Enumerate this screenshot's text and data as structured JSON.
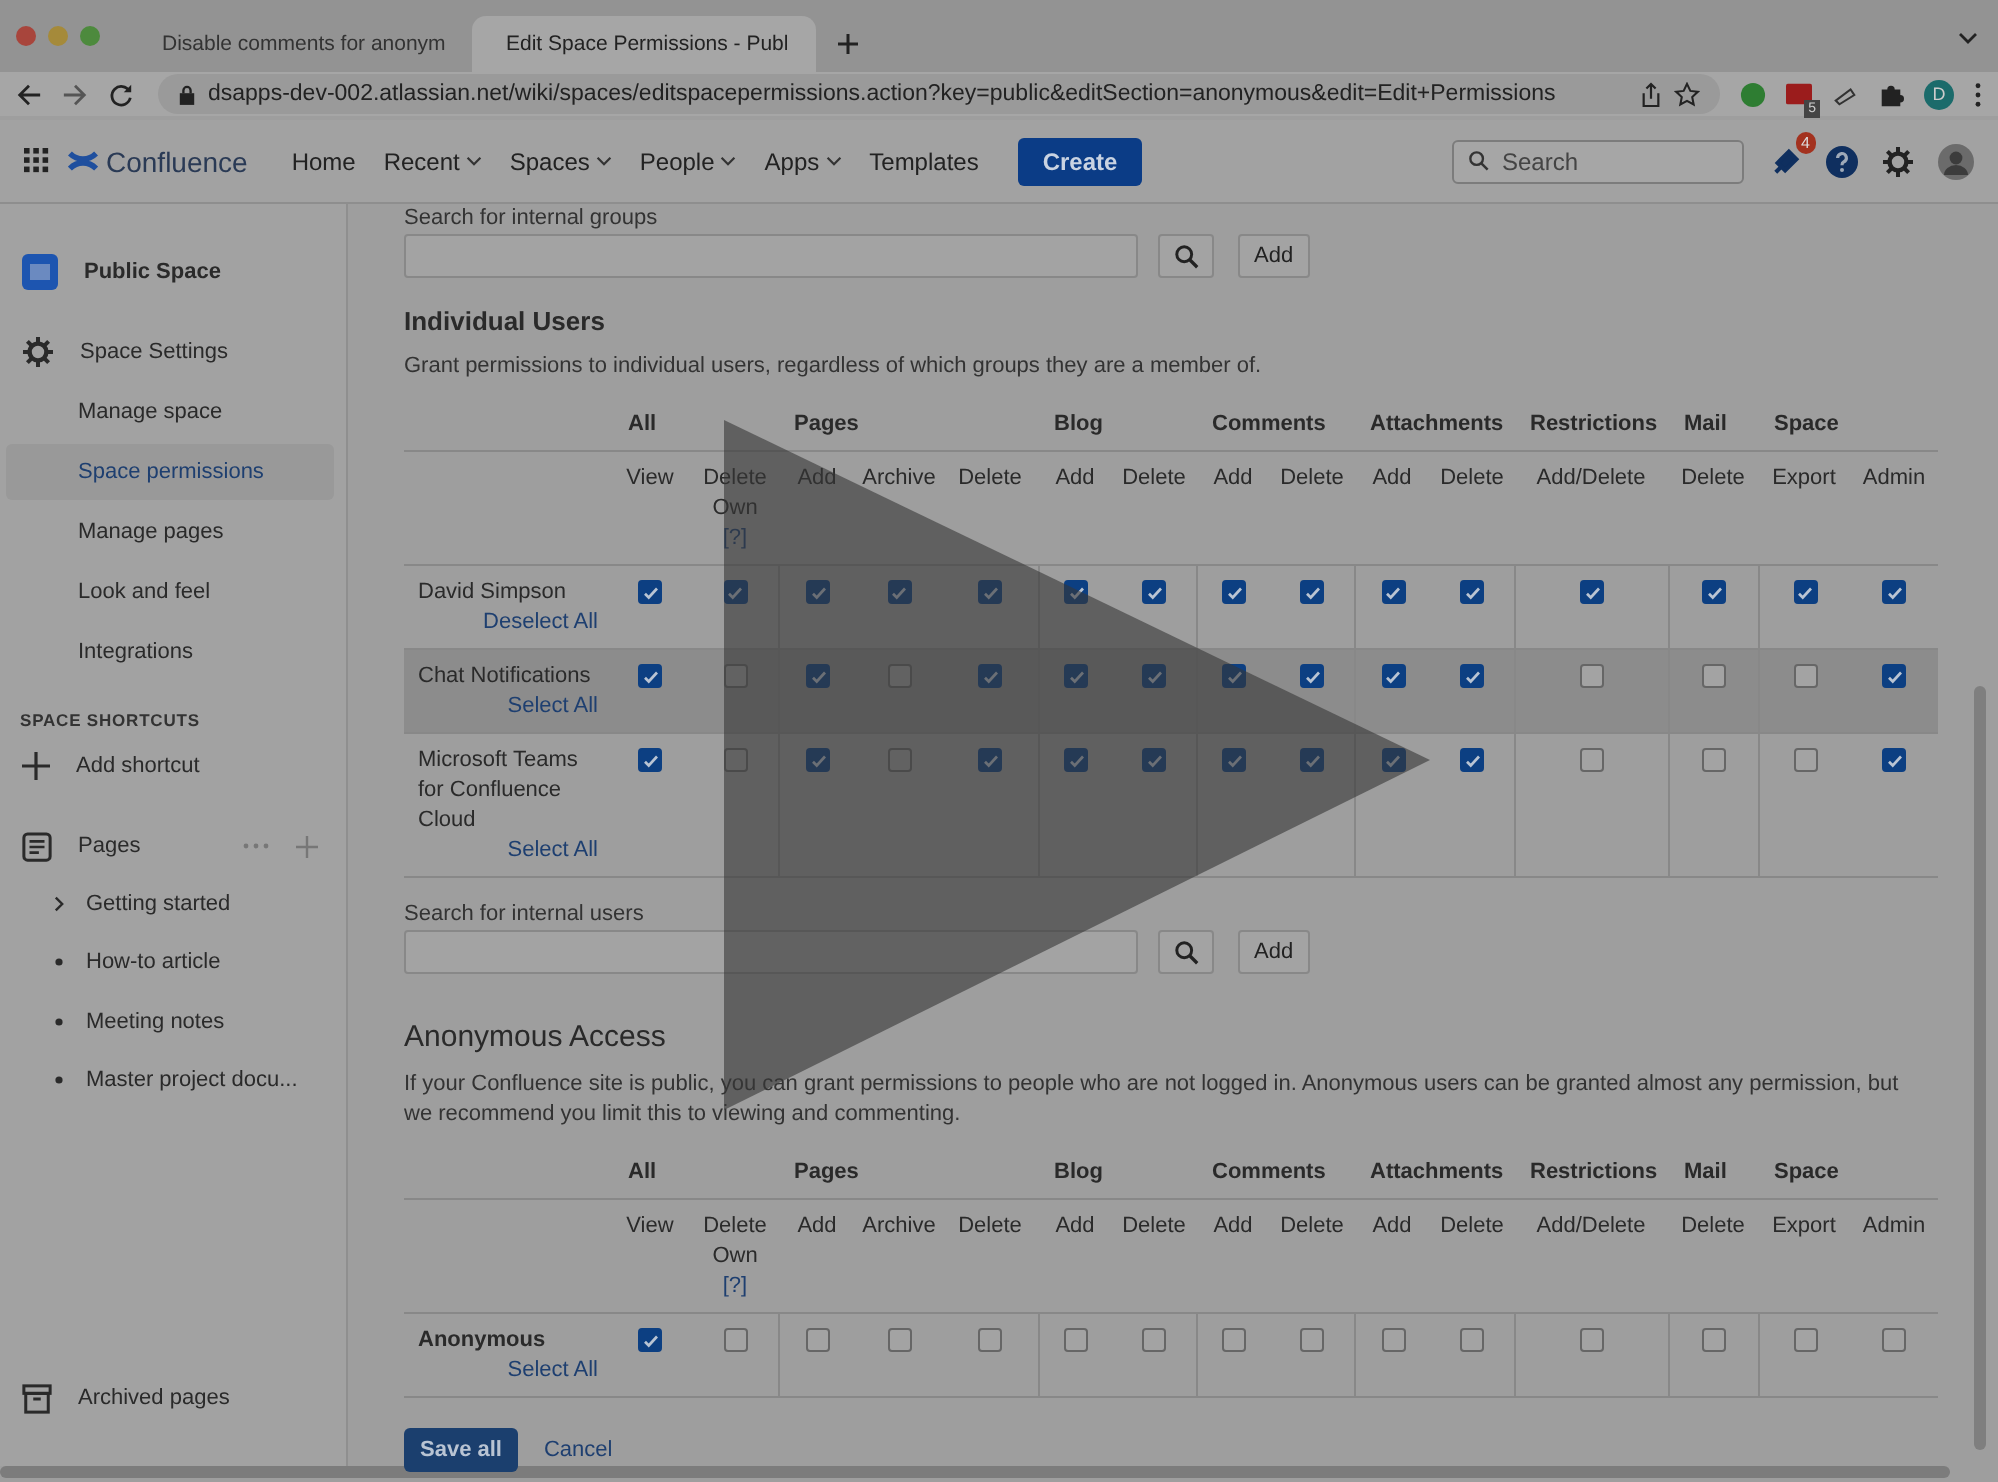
{
  "browser": {
    "tabs": [
      {
        "title": "Disable comments for anonym",
        "selected": false
      },
      {
        "title": "Edit Space Permissions - Publ",
        "selected": true
      }
    ],
    "url": "dsapps-dev-002.atlassian.net/wiki/spaces/editspacepermissions.action?key=public&editSection=anonymous&edit=Edit+Permissions",
    "extension_badge": "5",
    "profile": "D"
  },
  "nav": {
    "product": "Confluence",
    "items": [
      {
        "label": "Home",
        "dropdown": false
      },
      {
        "label": "Recent",
        "dropdown": true
      },
      {
        "label": "Spaces",
        "dropdown": true
      },
      {
        "label": "People",
        "dropdown": true
      },
      {
        "label": "Apps",
        "dropdown": true
      },
      {
        "label": "Templates",
        "dropdown": false
      }
    ],
    "create": "Create",
    "search": {
      "placeholder": "Search"
    },
    "notifications": "4"
  },
  "sidebar": {
    "space": "Public Space",
    "settings": {
      "label": "Space Settings",
      "items": [
        {
          "label": "Manage space",
          "selected": false
        },
        {
          "label": "Space permissions",
          "selected": true
        },
        {
          "label": "Manage pages",
          "selected": false
        },
        {
          "label": "Look and feel",
          "selected": false
        },
        {
          "label": "Integrations",
          "selected": false
        }
      ]
    },
    "shortcuts": {
      "heading": "SPACE SHORTCUTS",
      "add": "Add shortcut"
    },
    "pages": {
      "label": "Pages",
      "items": [
        {
          "label": "Getting started",
          "kind": "expandable"
        },
        {
          "label": "How-to article",
          "kind": "leaf"
        },
        {
          "label": "Meeting notes",
          "kind": "leaf"
        },
        {
          "label": "Master project docu...",
          "kind": "leaf"
        }
      ]
    },
    "archived": "Archived pages"
  },
  "groups_search": {
    "label": "Search for internal groups",
    "add": "Add"
  },
  "individual_users": {
    "heading": "Individual Users",
    "description": "Grant permissions to individual users, regardless of which groups they are a member of.",
    "groups": [
      {
        "label": "All",
        "columns": [
          {
            "label": "View"
          },
          {
            "label": "Delete Own",
            "help": "[?]"
          }
        ]
      },
      {
        "label": "Pages",
        "columns": [
          {
            "label": "Add"
          },
          {
            "label": "Archive"
          },
          {
            "label": "Delete"
          }
        ]
      },
      {
        "label": "Blog",
        "columns": [
          {
            "label": "Add"
          },
          {
            "label": "Delete"
          }
        ]
      },
      {
        "label": "Comments",
        "columns": [
          {
            "label": "Add"
          },
          {
            "label": "Delete"
          }
        ]
      },
      {
        "label": "Attachments",
        "columns": [
          {
            "label": "Add"
          },
          {
            "label": "Delete"
          }
        ]
      },
      {
        "label": "Restrictions",
        "columns": [
          {
            "label": "Add/Delete"
          }
        ]
      },
      {
        "label": "Mail",
        "columns": [
          {
            "label": "Delete"
          }
        ]
      },
      {
        "label": "Space",
        "columns": [
          {
            "label": "Export"
          },
          {
            "label": "Admin"
          }
        ]
      }
    ],
    "rows": [
      {
        "name": "David Simpson",
        "kind": "user",
        "action": "Deselect All",
        "hovered": false,
        "permissions": [
          {
            "checked": true
          },
          {
            "checked": true
          },
          {
            "checked": true
          },
          {
            "checked": true
          },
          {
            "checked": true
          },
          {
            "checked": true
          },
          {
            "checked": true
          },
          {
            "checked": true
          },
          {
            "checked": true
          },
          {
            "checked": true
          },
          {
            "checked": true
          },
          {
            "checked": true
          },
          {
            "checked": true
          },
          {
            "checked": true
          },
          {
            "checked": true
          }
        ]
      },
      {
        "name": "Chat Notifications",
        "kind": "user",
        "action": "Select All",
        "hovered": true,
        "permissions": [
          {
            "checked": true
          },
          {
            "checked": false
          },
          {
            "checked": true
          },
          {
            "checked": false
          },
          {
            "checked": true
          },
          {
            "checked": true
          },
          {
            "checked": true
          },
          {
            "checked": true
          },
          {
            "checked": true
          },
          {
            "checked": true
          },
          {
            "checked": true
          },
          {
            "checked": false
          },
          {
            "checked": false
          },
          {
            "checked": false
          },
          {
            "checked": true
          }
        ]
      },
      {
        "name": "Microsoft Teams for Confluence Cloud",
        "kind": "user",
        "action": "Select All",
        "hovered": false,
        "permissions": [
          {
            "checked": true
          },
          {
            "checked": false
          },
          {
            "checked": true
          },
          {
            "checked": false
          },
          {
            "checked": true
          },
          {
            "checked": true
          },
          {
            "checked": true
          },
          {
            "checked": true
          },
          {
            "checked": true
          },
          {
            "checked": true
          },
          {
            "checked": true
          },
          {
            "checked": false
          },
          {
            "checked": false
          },
          {
            "checked": false
          },
          {
            "checked": true
          }
        ]
      }
    ]
  },
  "users_search": {
    "label": "Search for internal users",
    "add": "Add"
  },
  "anonymous": {
    "heading": "Anonymous Access",
    "description": "If your Confluence site is public, you can grant permissions to people who are not logged in. Anonymous users can be granted almost any permission, but we recommend you limit this to viewing and commenting.",
    "groups": [
      {
        "label": "All",
        "columns": [
          {
            "label": "View"
          },
          {
            "label": "Delete Own",
            "help": "[?]"
          }
        ]
      },
      {
        "label": "Pages",
        "columns": [
          {
            "label": "Add"
          },
          {
            "label": "Archive"
          },
          {
            "label": "Delete"
          }
        ]
      },
      {
        "label": "Blog",
        "columns": [
          {
            "label": "Add"
          },
          {
            "label": "Delete"
          }
        ]
      },
      {
        "label": "Comments",
        "columns": [
          {
            "label": "Add"
          },
          {
            "label": "Delete"
          }
        ]
      },
      {
        "label": "Attachments",
        "columns": [
          {
            "label": "Add"
          },
          {
            "label": "Delete"
          }
        ]
      },
      {
        "label": "Restrictions",
        "columns": [
          {
            "label": "Add/Delete"
          }
        ]
      },
      {
        "label": "Mail",
        "columns": [
          {
            "label": "Delete"
          }
        ]
      },
      {
        "label": "Space",
        "columns": [
          {
            "label": "Export"
          },
          {
            "label": "Admin"
          }
        ]
      }
    ],
    "rows": [
      {
        "name": "Anonymous",
        "kind": "anonymous",
        "action": "Select All",
        "hovered": false,
        "permissions": [
          {
            "checked": true
          },
          {
            "checked": false
          },
          {
            "checked": false
          },
          {
            "checked": false
          },
          {
            "checked": false
          },
          {
            "checked": false
          },
          {
            "checked": false
          },
          {
            "checked": false
          },
          {
            "checked": false
          },
          {
            "checked": false
          },
          {
            "checked": false
          },
          {
            "checked": false
          },
          {
            "checked": false
          },
          {
            "checked": false
          },
          {
            "checked": false
          }
        ]
      }
    ]
  },
  "actions": {
    "save": "Save all",
    "cancel": "Cancel"
  }
}
